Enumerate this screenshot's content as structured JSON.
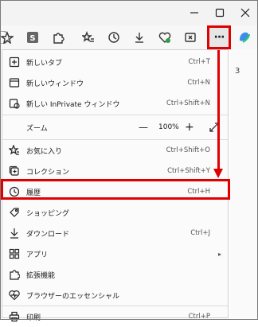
{
  "window": {
    "minimize": "—",
    "maximize": "☐",
    "close": "✕"
  },
  "toolbar": {
    "more_label": "···"
  },
  "menu": {
    "items": [
      {
        "label": "新しいタブ",
        "shortcut": "Ctrl+T"
      },
      {
        "label": "新しいウィンドウ",
        "shortcut": "Ctrl+N"
      },
      {
        "label": "新しい InPrivate ウィンドウ",
        "shortcut": "Ctrl+Shift+N"
      },
      {
        "label": "ズーム",
        "shortcut": ""
      },
      {
        "label": "お気に入り",
        "shortcut": "Ctrl+Shift+O"
      },
      {
        "label": "コレクション",
        "shortcut": "Ctrl+Shift+Y"
      },
      {
        "label": "履歴",
        "shortcut": "Ctrl+H"
      },
      {
        "label": "ショッピング",
        "shortcut": ""
      },
      {
        "label": "ダウンロード",
        "shortcut": "Ctrl+J"
      },
      {
        "label": "アプリ",
        "shortcut": ""
      },
      {
        "label": "拡張機能",
        "shortcut": ""
      },
      {
        "label": "ブラウザーのエッセンシャル",
        "shortcut": ""
      },
      {
        "label": "印刷",
        "shortcut": "Ctrl+P"
      }
    ],
    "zoom": {
      "minus": "—",
      "value": "100%",
      "plus": "+"
    },
    "submenu_arrow": "▸"
  },
  "colors": {
    "highlight": "#e00000"
  }
}
